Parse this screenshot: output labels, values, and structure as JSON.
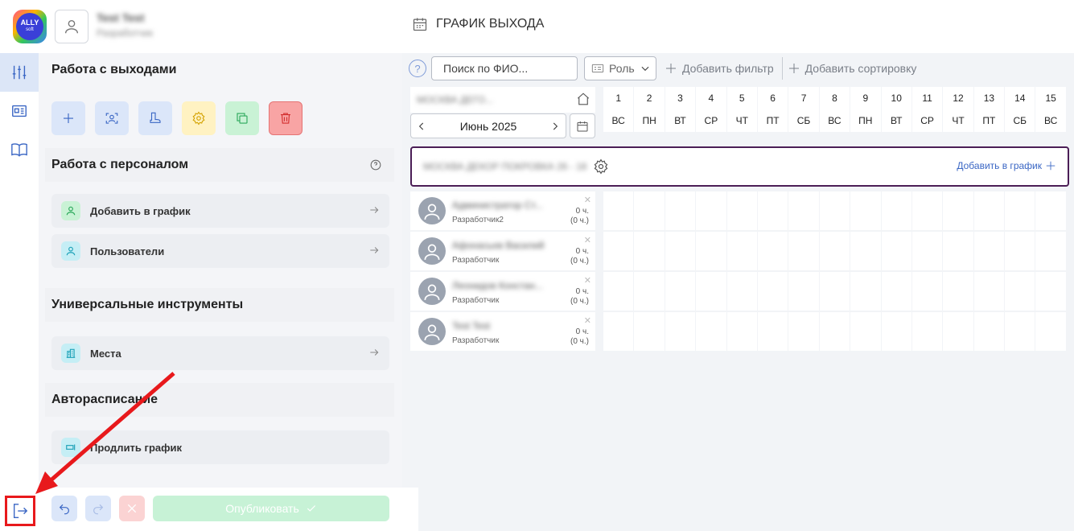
{
  "header": {
    "logo_text": "ALLY",
    "logo_sub": "soft",
    "user_name": "Test Test",
    "user_role": "Разработчик",
    "page_title": "ГРАФИК ВЫХОДА"
  },
  "panel": {
    "section1_title": "Работа с выходами",
    "section2_title": "Работа с персоналом",
    "section2_help": "?",
    "add_to_schedule": "Добавить в график",
    "users": "Пользователи",
    "section3_title": "Универсальные инструменты",
    "places": "Места",
    "section4_title": "Авторасписание",
    "extend_schedule": "Продлить график"
  },
  "bottom": {
    "publish_label": "Опубликовать"
  },
  "toolbar": {
    "help": "?",
    "search_placeholder": "Поиск по ФИО...",
    "role_label": "Роль",
    "add_filter": "Добавить фильтр",
    "add_sort": "Добавить сортировку"
  },
  "calendar": {
    "location": "МОСКВА ДЕГО...",
    "month": "Июнь 2025",
    "days": [
      {
        "num": "1",
        "wd": "ВС"
      },
      {
        "num": "2",
        "wd": "ПН"
      },
      {
        "num": "3",
        "wd": "ВТ"
      },
      {
        "num": "4",
        "wd": "СР"
      },
      {
        "num": "5",
        "wd": "ЧТ"
      },
      {
        "num": "6",
        "wd": "ПТ"
      },
      {
        "num": "7",
        "wd": "СБ"
      },
      {
        "num": "8",
        "wd": "ВС"
      },
      {
        "num": "9",
        "wd": "ПН"
      },
      {
        "num": "10",
        "wd": "ВТ"
      },
      {
        "num": "11",
        "wd": "СР"
      },
      {
        "num": "12",
        "wd": "ЧТ"
      },
      {
        "num": "13",
        "wd": "ПТ"
      },
      {
        "num": "14",
        "wd": "СБ"
      },
      {
        "num": "15",
        "wd": "ВС"
      }
    ]
  },
  "group": {
    "name": "МОСКВА ДЕКОР ПОКРОВКА 26 - 18",
    "add_label": "Добавить в график"
  },
  "employees": [
    {
      "name": "Администратор Ст...",
      "role": "Разработчик2",
      "hours": "0 ч.",
      "hours2": "(0 ч.)"
    },
    {
      "name": "Афонасьев Василий",
      "role": "Разработчик",
      "hours": "0 ч.",
      "hours2": "(0 ч.)"
    },
    {
      "name": "Леонидов Констан...",
      "role": "Разработчик",
      "hours": "0 ч.",
      "hours2": "(0 ч.)"
    },
    {
      "name": "Test Test",
      "role": "Разработчик",
      "hours": "0 ч.",
      "hours2": "(0 ч.)"
    }
  ],
  "colors": {
    "accent": "#3a66c4",
    "group_border": "#4b1e56",
    "annotation": "#e8191c",
    "publish_bg": "#c7f2d6"
  }
}
